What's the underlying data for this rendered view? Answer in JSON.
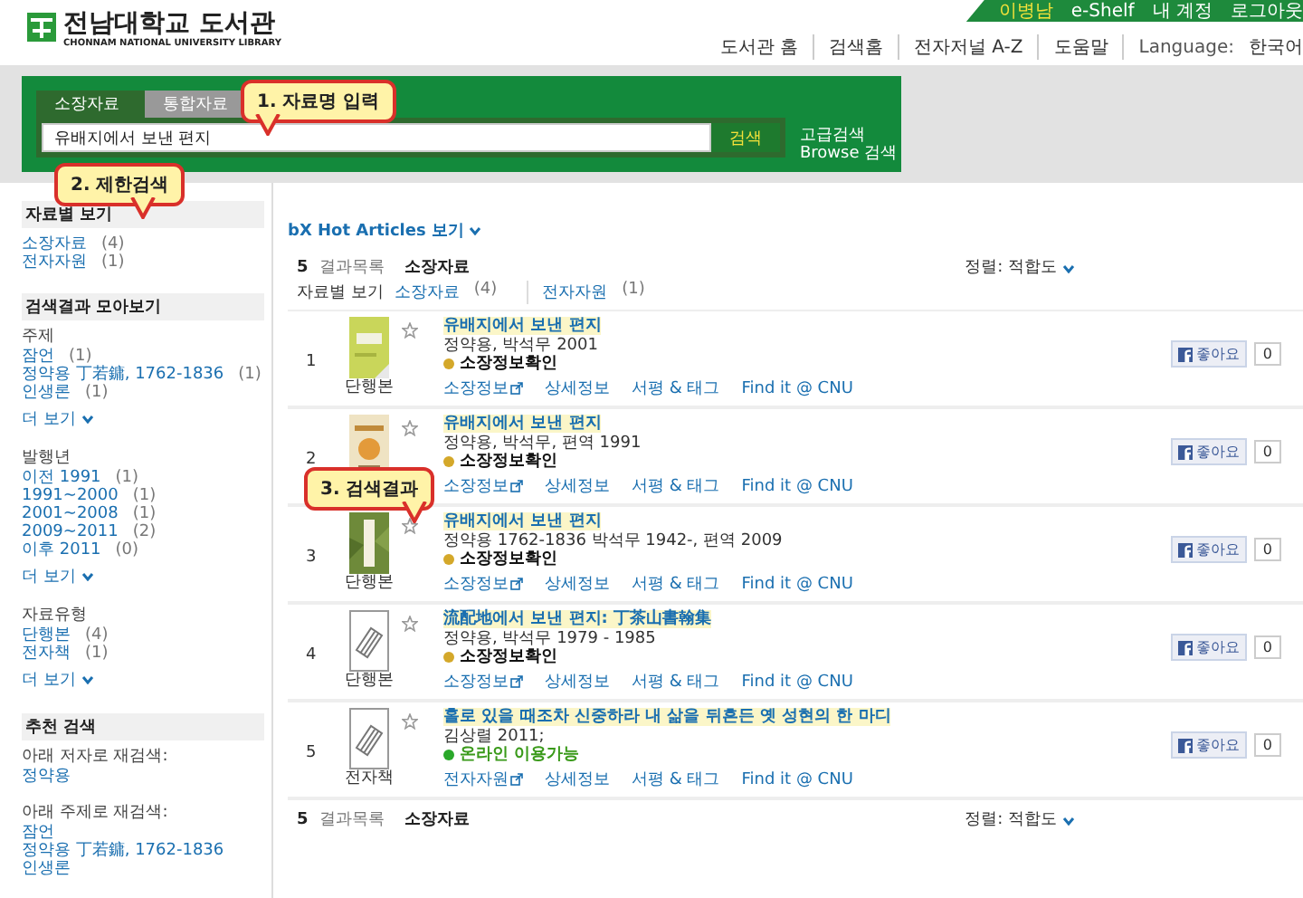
{
  "header": {
    "logo": {
      "title": "전남대학교 도서관",
      "subtitle": "CHONNAM NATIONAL UNIVERSITY LIBRARY"
    },
    "user_menu": [
      {
        "label": "이병남",
        "kind": "user"
      },
      {
        "label": "e-Shelf",
        "kind": "link"
      },
      {
        "label": "내 계정",
        "kind": "link"
      },
      {
        "label": "로그아웃",
        "kind": "link"
      }
    ],
    "nav": [
      "도서관 홈",
      "검색홈",
      "전자저널 A-Z",
      "도움말"
    ],
    "language": {
      "label": "Language:",
      "value": "한국어"
    }
  },
  "search": {
    "tabs": [
      {
        "label": "소장자료",
        "selected": true
      },
      {
        "label": "통합자료",
        "selected": false
      }
    ],
    "value": "유배지에서 보낸 편지",
    "button": "검색",
    "side_links": [
      "고급검색",
      "Browse 검색"
    ]
  },
  "callouts": [
    {
      "text": "1. 자료명 입력"
    },
    {
      "text": "2. 제한검색"
    },
    {
      "text": "3. 검색결과"
    }
  ],
  "sidebar": [
    {
      "heading": "자료별 보기",
      "groups": [
        {
          "items": [
            {
              "label": "소장자료",
              "count": "(4)"
            },
            {
              "label": "전자자원",
              "count": "(1)"
            }
          ]
        }
      ]
    },
    {
      "heading": "검색결과 모아보기",
      "groups": [
        {
          "title": "주제",
          "items": [
            {
              "label": "잠언",
              "count": "(1)"
            },
            {
              "label": "정약용 丁若鏞, 1762-1836",
              "count": "(1)"
            },
            {
              "label": "인생론",
              "count": "(1)"
            }
          ],
          "more": "더 보기"
        },
        {
          "title": "발행년",
          "items": [
            {
              "label": "이전 1991",
              "count": "(1)"
            },
            {
              "label": "1991~2000",
              "count": "(1)"
            },
            {
              "label": "2001~2008",
              "count": "(1)"
            },
            {
              "label": "2009~2011",
              "count": "(2)"
            },
            {
              "label": "이후 2011",
              "count": "(0)"
            }
          ],
          "more": "더 보기"
        },
        {
          "title": "자료유형",
          "items": [
            {
              "label": "단행본",
              "count": "(4)"
            },
            {
              "label": "전자책",
              "count": "(1)"
            }
          ],
          "more": "더 보기"
        }
      ]
    },
    {
      "heading": "추천 검색",
      "groups": [
        {
          "title": "아래 저자로 재검색:",
          "items": [
            {
              "label": "정약용"
            }
          ]
        },
        {
          "title": "아래 주제로 재검색:",
          "items": [
            {
              "label": "잠언"
            },
            {
              "label": "정약용 丁若鏞, 1762-1836"
            },
            {
              "label": "인생론"
            }
          ]
        }
      ]
    }
  ],
  "results": {
    "hot_articles": "bX Hot Articles 보기",
    "summary": {
      "count": "5",
      "label": "결과목록",
      "scope": "소장자료"
    },
    "sort": "정렬: 적합도",
    "filter": {
      "label": "자료별 보기",
      "tabs": [
        {
          "label": "소장자료",
          "count": "(4)"
        },
        {
          "label": "전자자원",
          "count": "(1)"
        }
      ]
    },
    "rows": [
      {
        "number": "1",
        "kind": "picture",
        "format": "단행본",
        "title": "유배지에서 보낸 편지",
        "author": "정약용, 박석무 2001",
        "status": {
          "text": "소장정보확인",
          "kind": "holding",
          "color": "#d4a82a"
        },
        "links": [
          "소장정보",
          "상세정보",
          "서평 & 태그",
          "Find it @ CNU"
        ],
        "like": "좋아요",
        "like_count": "0"
      },
      {
        "number": "2",
        "kind": "picture",
        "title": "유배지에서 보낸 편지",
        "author": "정약용, 박석무, 편역 1991",
        "status": {
          "text": "소장정보확인",
          "kind": "holding",
          "color": "#d4a82a"
        },
        "links": [
          "소장정보",
          "상세정보",
          "서평 & 태그",
          "Find it @ CNU"
        ],
        "like": "좋아요",
        "like_count": "0"
      },
      {
        "number": "3",
        "kind": "picture",
        "format": "단행본",
        "title": "유배지에서 보낸 편지",
        "author": "정약용 1762-1836 박석무 1942-, 편역 2009",
        "status": {
          "text": "소장정보확인",
          "kind": "holding",
          "color": "#d4a82a"
        },
        "links": [
          "소장정보",
          "상세정보",
          "서평 & 태그",
          "Find it @ CNU"
        ],
        "like": "좋아요",
        "like_count": "0"
      },
      {
        "number": "4",
        "kind": "placeholder",
        "format": "단행본",
        "title": "流配地에서 보낸 편지: 丁茶山書翰集",
        "author": "정약용, 박석무 1979 - 1985",
        "status": {
          "text": "소장정보확인",
          "kind": "holding",
          "color": "#d4a82a"
        },
        "links": [
          "소장정보",
          "상세정보",
          "서평 & 태그",
          "Find it @ CNU"
        ],
        "like": "좋아요",
        "like_count": "0"
      },
      {
        "number": "5",
        "kind": "placeholder",
        "format": "전자책",
        "title": "홀로 있을 때조차 신중하라 내 삶을 뒤흔든 옛 성현의 한 마디",
        "author": "김상렬 2011;",
        "status": {
          "text": "온라인 이용가능",
          "kind": "online",
          "color": "#2aa82a"
        },
        "links": [
          "전자자원",
          "상세정보",
          "서평 & 태그",
          "Find it @ CNU"
        ],
        "like": "좋아요",
        "like_count": "0"
      }
    ],
    "footer": {
      "count": "5",
      "label": "결과목록",
      "scope": "소장자료",
      "sort": "정렬: 적합도"
    }
  }
}
